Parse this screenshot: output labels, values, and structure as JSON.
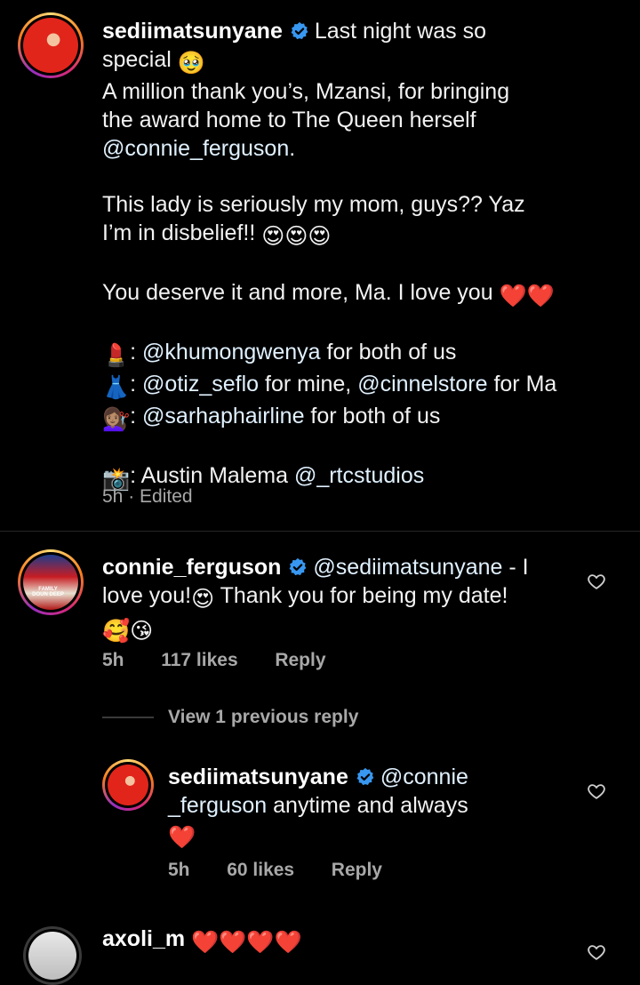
{
  "caption": {
    "username": "sediimatsunyane",
    "line1": "Last night was so",
    "line2": "special",
    "line3": "A million thank you’s, Mzansi, for bringing",
    "line4": "the award home to The Queen herself",
    "line5": "@connie_ferguson.",
    "line6": "This lady is seriously my mom, guys?? Yaz",
    "line7": "I’m in disbelief!!",
    "line8": "You deserve it and more, Ma. I love you",
    "credit1_sep": ":",
    "credit1_mention": "@khumongwenya",
    "credit1_text": "for both of us",
    "credit2_sep": ":",
    "credit2_mention": "@otiz_seflo",
    "credit2_text": "for mine,",
    "credit2_mention2": "@cinnelstore",
    "credit2_text2": "for Ma",
    "credit3_sep": ":",
    "credit3_mention": "@sarhaphairline",
    "credit3_text": "for both of us",
    "credit4_text": ": Austin Malema",
    "credit4_mention": "@_rtcstudios",
    "time": "5h",
    "dot": "·",
    "edited": "Edited",
    "emojis": {
      "pleading": "🥹",
      "heart_eyes": "😍",
      "heart": "❤️",
      "lipstick": "💄",
      "dress": "👗",
      "haircut": "💇🏽‍♀️",
      "camera": "📸",
      "smiling_hearts": "🥰",
      "kiss": "😘"
    }
  },
  "comment1": {
    "username": "connie_ferguson",
    "mention": "@sediimatsunyane",
    "text_a": "- I",
    "text_b": "love you!",
    "text_c": "Thank you for being my date!",
    "time": "5h",
    "likes": "117 likes",
    "reply": "Reply",
    "avatar_text": "FAMILY DOUN DEEP"
  },
  "view_replies": "View 1 previous reply",
  "reply1": {
    "username": "sediimatsunyane",
    "mention_a": "@connie",
    "mention_b": "_ferguson",
    "text": "anytime and always",
    "time": "5h",
    "likes": "60 likes",
    "reply": "Reply"
  },
  "comment2": {
    "username": "axoli_m"
  },
  "colors": {
    "background": "#000000",
    "verified": "#3897f0",
    "meta": "#a8a8a8",
    "heart": "#e8262b"
  }
}
